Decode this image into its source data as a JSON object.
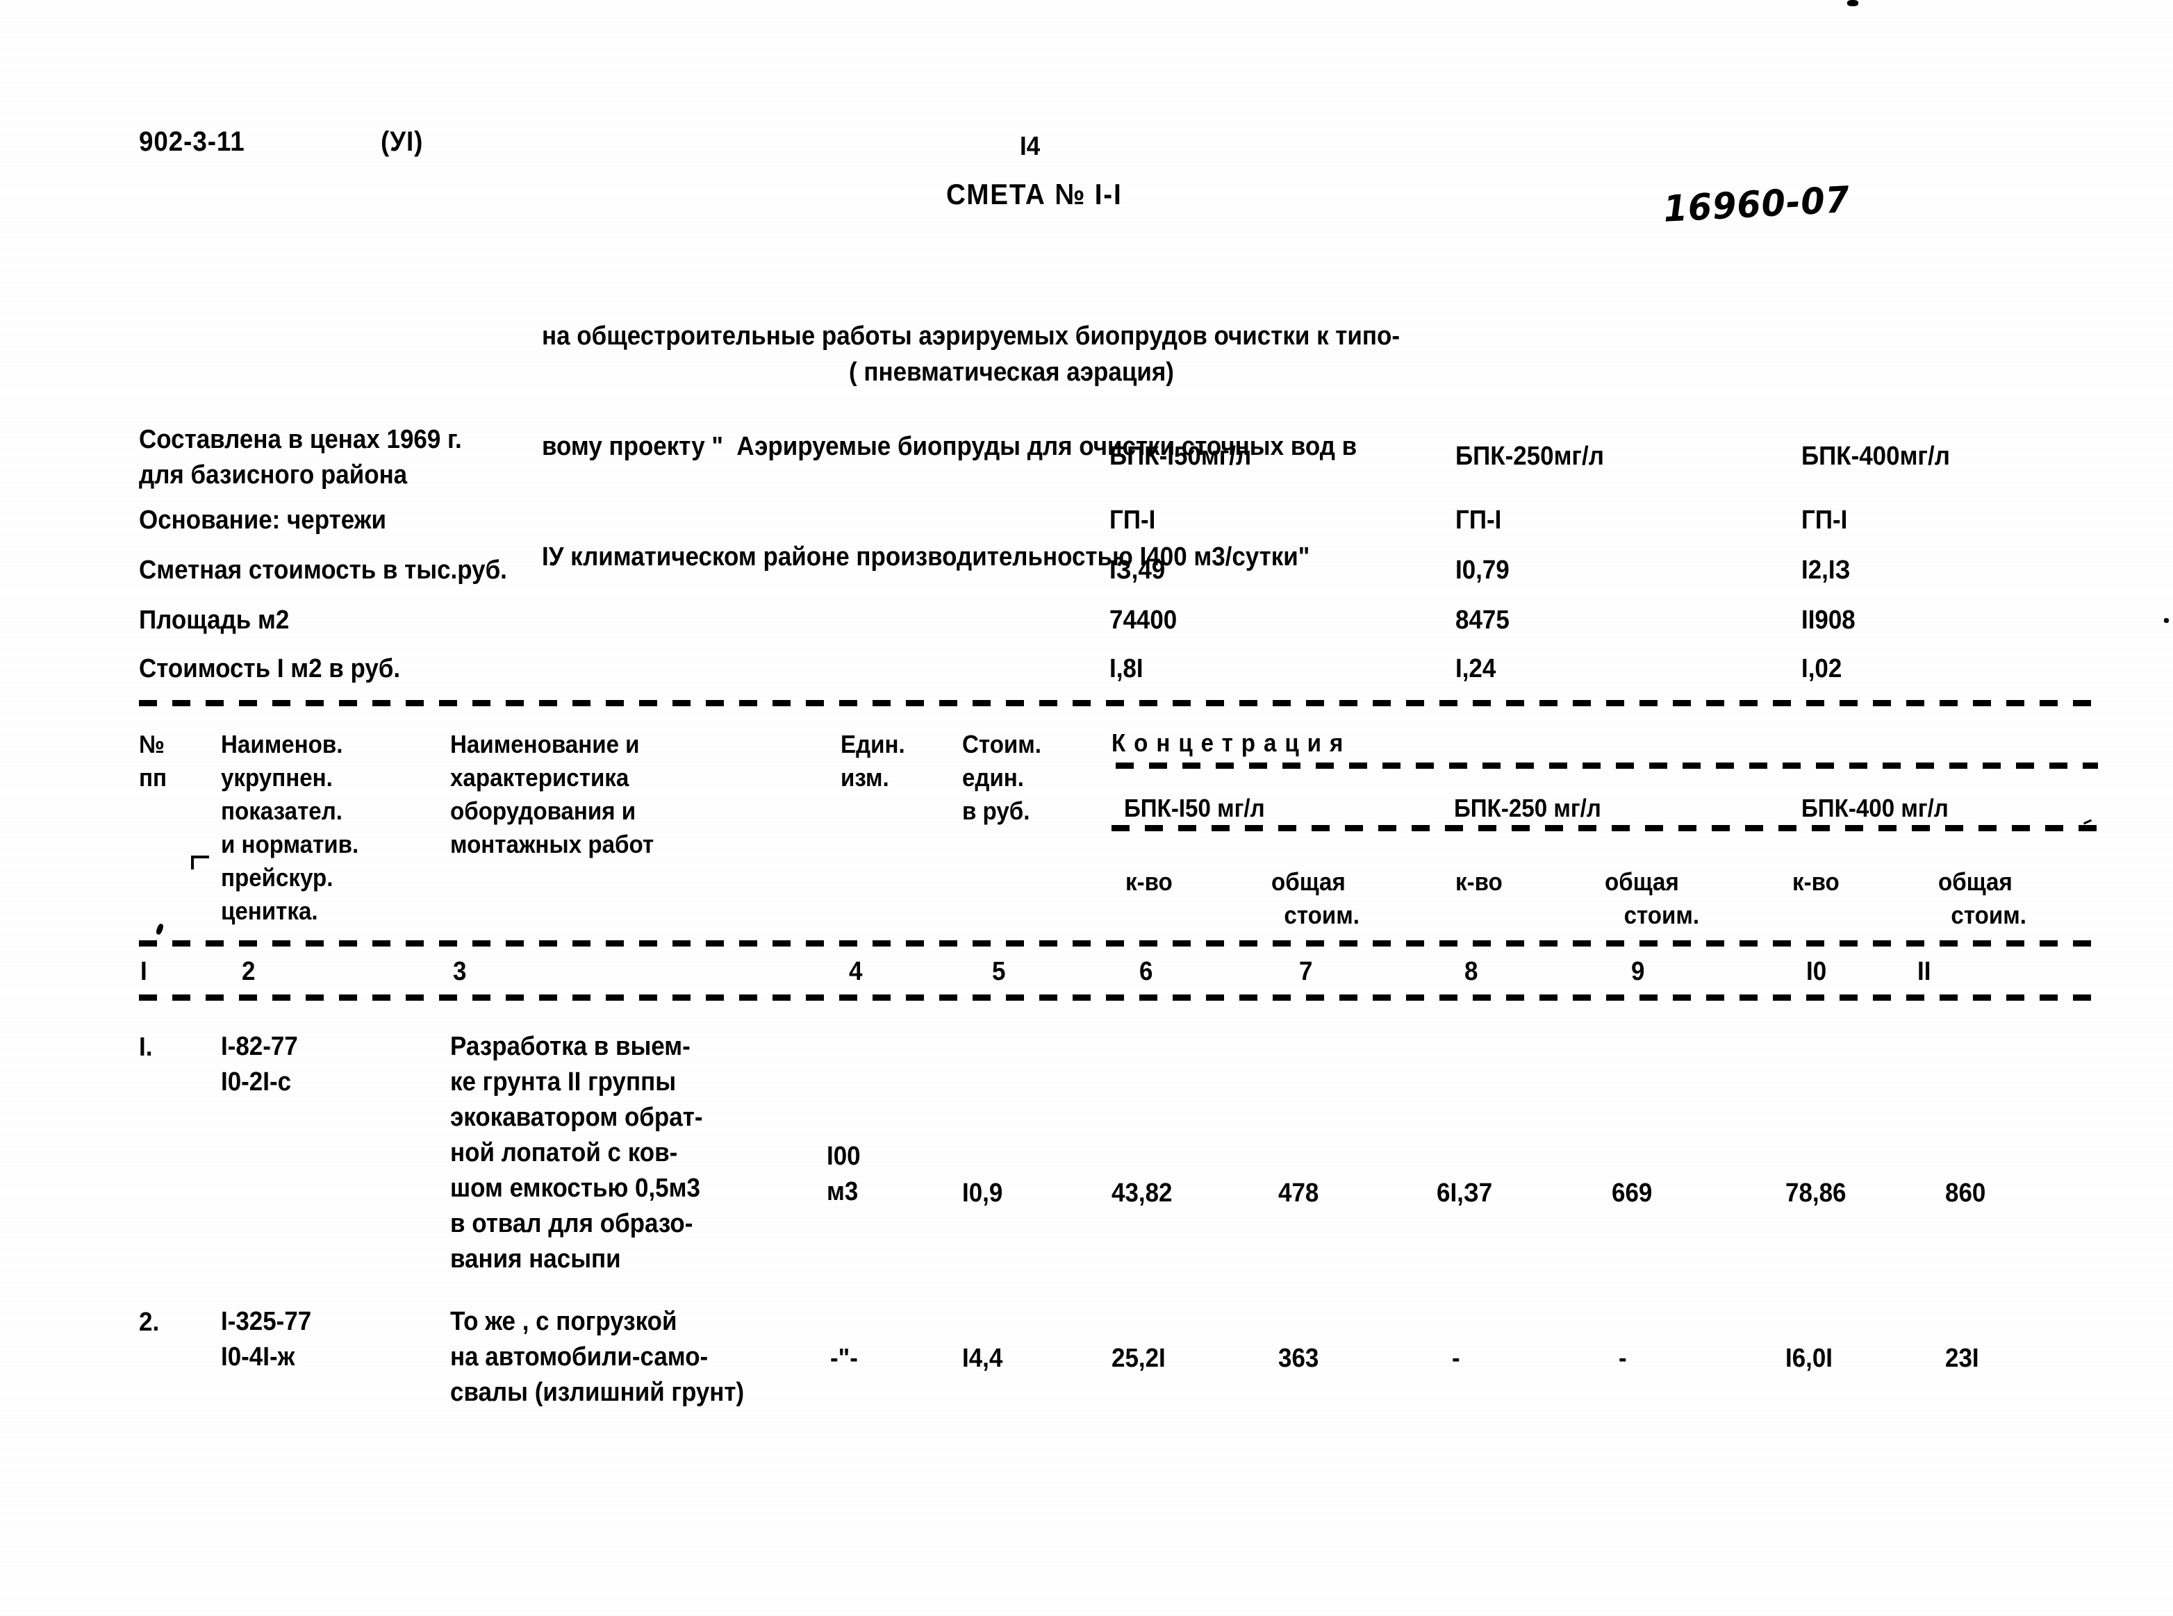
{
  "header": {
    "doc_code": "902-3-11",
    "volume": "(УІ)",
    "page_number": "І4",
    "smeta_title": "СМЕТА № І-І",
    "hand_written_code": "16960-07"
  },
  "intro": {
    "line1": "на общестроительные работы аэрируемых биопрудов очистки к типо-",
    "line2": "вому проекту \"  Аэрируемые биопруды для очистки сточных вод в",
    "line3": "ІУ климатическом районе производительностью І400 м3/сутки\"",
    "line4": "( пневматическая аэрация)"
  },
  "info": {
    "labels": [
      "Составлена в ценах 1969 г.\nдля базисного района",
      "Основание: чертежи",
      "Сметная стоимость в тыс.руб.",
      "Площадь м2",
      "Стоимость І м2 в руб."
    ],
    "label_1a": "Составлена в ценах 1969 г.",
    "label_1b": "для базисного района",
    "label_2": "Основание: чертежи",
    "label_3": "Сметная стоимость в тыс.руб.",
    "label_4": "Площадь м2",
    "label_5": "Стоимость І м2 в руб.",
    "columns": [
      {
        "bpk": "БПК-І50мг/л",
        "osnovanie": "ГП-І",
        "smetnaya_stoimost": "ІЗ,49",
        "ploshad": "74400",
        "stoimost_m2": "І,8І"
      },
      {
        "bpk": "БПК-250мг/л",
        "osnovanie": "ГП-І",
        "smetnaya_stoimost": "І0,79",
        "ploshad": "8475",
        "stoimost_m2": "І,24"
      },
      {
        "bpk": "БПК-400мг/л",
        "osnovanie": "ГП-І",
        "smetnaya_stoimost": "І2,ІЗ",
        "ploshad": "ІІ908",
        "stoimost_m2": "І,02"
      }
    ]
  },
  "table": {
    "header": {
      "col1": "№\nпп",
      "col2": "Наименов.\nукрупнен.\nпоказател.\nи норматив.\nпрейскур.\nценитка.",
      "col3": "Наименование и\nхарактеристика\nоборудования и\nмонтажных работ",
      "col4": "Един.\nизм.",
      "col5": "Стоим.\nедин.\nв руб.",
      "concentration": "Концетрация",
      "bpk1": "БПК-І50 мг/л",
      "bpk2": "БПК-250 мг/л",
      "bpk3": "БПК-400 мг/л",
      "sub_kvo": "к-во",
      "sub_obshaya": "общая\n  стоим.",
      "sub_obshaya_b": "общая\n   стоим.",
      "sub_obshaya_c": "общая\n  стоим."
    },
    "column_numbers": [
      "І",
      "2",
      "3",
      "4",
      "5",
      "6",
      "7",
      "8",
      "9",
      "І0",
      "ІІ"
    ],
    "rows": [
      {
        "no": "І.",
        "code": "І-82-77\nІ0-2І-с",
        "description": "Разработка в выем-\nке грунта ІІ группы\nэкокаватором обрат-\nной лопатой с ков-\nшом емкостью 0,5м3\nв отвал для образо-\nвания насыпи",
        "unit": "І00\nм3",
        "unit_cost": "І0,9",
        "bpk150_qty": "43,82",
        "bpk150_total": "478",
        "bpk250_qty": "6І,З7",
        "bpk250_total": "669",
        "bpk400_qty": "78,86",
        "bpk400_total": "860"
      },
      {
        "no": "2.",
        "code": "І-325-77\nІ0-4І-ж",
        "description": "То же , с погрузкой\nна автомобили-само-\nсвалы (излишний грунт)",
        "unit": "-\"-",
        "unit_cost": "І4,4",
        "bpk150_qty": "25,2І",
        "bpk150_total": "363",
        "bpk250_qty": "-",
        "bpk250_total": "-",
        "bpk400_qty": "І6,0І",
        "bpk400_total": "23І"
      }
    ]
  },
  "colors": {
    "paper": "#ffffff",
    "ink": "#000000"
  }
}
